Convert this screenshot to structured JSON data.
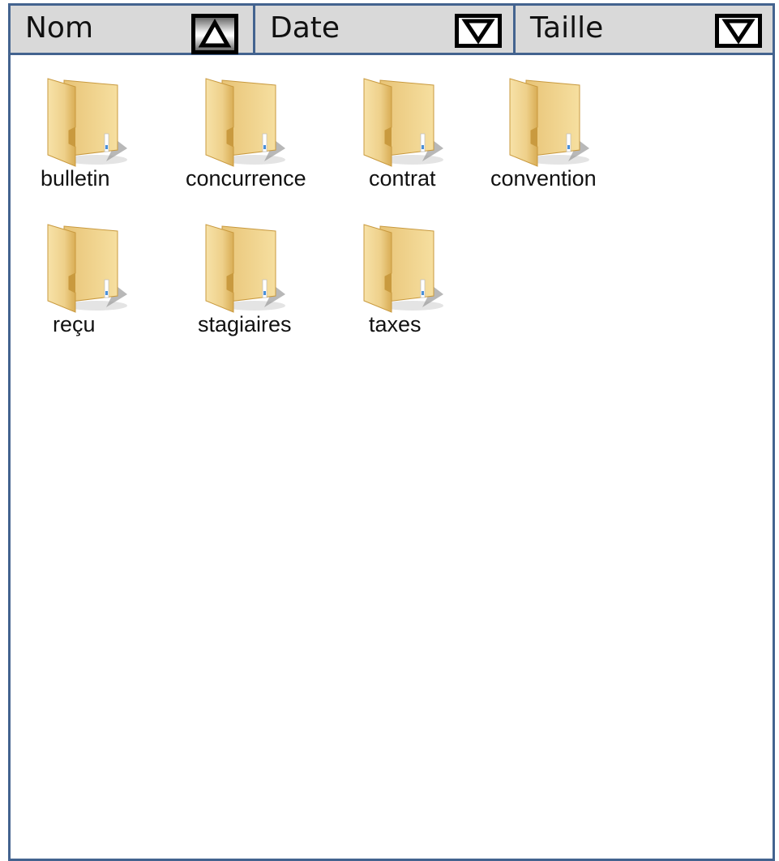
{
  "header": {
    "columns": [
      {
        "label": "Nom",
        "sort": "ascending",
        "active": true
      },
      {
        "label": "Date",
        "sort": "descending",
        "active": false
      },
      {
        "label": "Taille",
        "sort": "descending",
        "active": false
      }
    ]
  },
  "items": [
    {
      "name": "bulletin",
      "icon": "folder-icon"
    },
    {
      "name": "concurrence",
      "icon": "folder-icon"
    },
    {
      "name": "contrat",
      "icon": "folder-icon"
    },
    {
      "name": "convention",
      "icon": "folder-icon"
    },
    {
      "name": "reçu",
      "icon": "folder-icon"
    },
    {
      "name": "stagiaires",
      "icon": "folder-icon"
    },
    {
      "name": "taxes",
      "icon": "folder-icon"
    }
  ],
  "colors": {
    "border": "#43638f",
    "header_bg": "#d9d9d9",
    "folder_light": "#f6dfa0",
    "folder_dark": "#c99a3f"
  }
}
